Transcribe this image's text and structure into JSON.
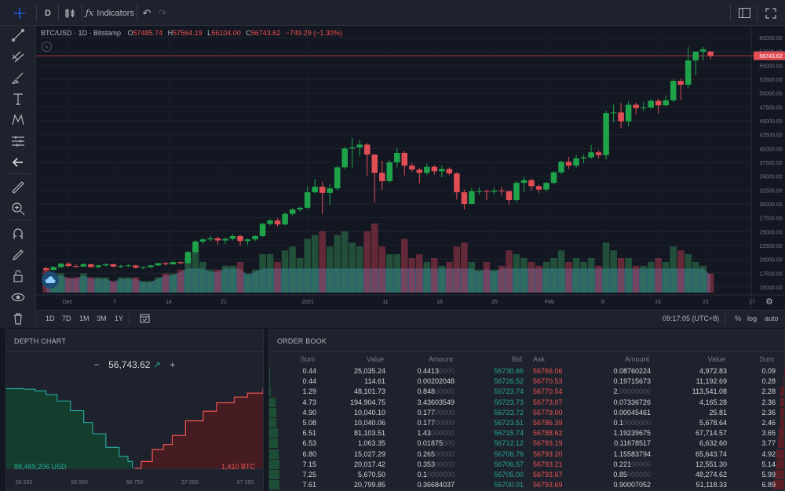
{
  "toolbar": {
    "interval": "D",
    "indicators_label": "Indicators"
  },
  "legend": {
    "symbol": "BTC/USD · 1D · Bitstamp",
    "open_key": "O",
    "open": "57485.74",
    "high_key": "H",
    "high": "57564.19",
    "low_key": "L",
    "low": "56104.00",
    "close_key": "C",
    "close": "56743.62",
    "change": "−749.29 (−1.30%)"
  },
  "price_axis": {
    "labels": [
      "60000.00",
      "57500.00",
      "56743.62",
      "55000.00",
      "52500.00",
      "50000.00",
      "47500.00",
      "45000.00",
      "42500.00",
      "40000.00",
      "37500.00",
      "35000.00",
      "32500.00",
      "30000.00",
      "27500.00",
      "25000.00",
      "22500.00",
      "20000.00",
      "17500.00",
      "15000.00"
    ],
    "last_price": "56743.62"
  },
  "time_axis": {
    "labels": [
      "Dec",
      "7",
      "14",
      "21",
      "2021",
      "11",
      "18",
      "25",
      "Feb",
      "8",
      "15",
      "21",
      "27"
    ]
  },
  "range_bar": {
    "ranges": [
      "1D",
      "7D",
      "1M",
      "3M",
      "1Y"
    ],
    "clock": "09:17:05 (UTC+8)",
    "percent": "%",
    "log": "log",
    "auto": "auto"
  },
  "colors": {
    "up": "#26a69a",
    "down": "#ef5350",
    "up_candle": "#1fa34a",
    "down_candle": "#e04d55",
    "volume_area": "#4a8cc2",
    "background": "#131722"
  },
  "chart_data": {
    "type": "candlestick",
    "title": "BTC/USD · 1D · Bitstamp",
    "ylim": [
      14000,
      61000
    ],
    "x_start": "2020-11-22",
    "x_labels": [
      "Dec",
      "7",
      "14",
      "21",
      "2021",
      "11",
      "18",
      "25",
      "Feb",
      "8",
      "15",
      "21",
      "27"
    ],
    "candles": [
      [
        18400,
        18700,
        17800,
        18100
      ],
      [
        18100,
        18800,
        17900,
        18600
      ],
      [
        18600,
        19400,
        18400,
        19200
      ],
      [
        19200,
        19500,
        18600,
        18800
      ],
      [
        18800,
        19100,
        18500,
        18700
      ],
      [
        18700,
        19300,
        18600,
        19100
      ],
      [
        19100,
        19200,
        18500,
        18600
      ],
      [
        18600,
        19000,
        18400,
        18900
      ],
      [
        18900,
        19300,
        18700,
        19100
      ],
      [
        19100,
        19200,
        18500,
        18700
      ],
      [
        18700,
        19000,
        18400,
        18800
      ],
      [
        18800,
        19100,
        18600,
        18900
      ],
      [
        18900,
        19000,
        18300,
        18500
      ],
      [
        18500,
        18700,
        18200,
        18600
      ],
      [
        18600,
        19000,
        18400,
        18900
      ],
      [
        18900,
        19400,
        18800,
        19300
      ],
      [
        19300,
        19500,
        18900,
        19100
      ],
      [
        19100,
        19700,
        19000,
        19500
      ],
      [
        19500,
        19600,
        19100,
        19300
      ],
      [
        19300,
        21600,
        19200,
        21300
      ],
      [
        21300,
        23500,
        21100,
        23200
      ],
      [
        23200,
        23900,
        22800,
        23600
      ],
      [
        23600,
        24300,
        23200,
        23800
      ],
      [
        23800,
        24100,
        22700,
        23400
      ],
      [
        23400,
        23900,
        22800,
        23700
      ],
      [
        23700,
        24500,
        23400,
        24200
      ],
      [
        24200,
        24400,
        22500,
        23300
      ],
      [
        23300,
        23800,
        22600,
        23600
      ],
      [
        23600,
        24400,
        23300,
        24200
      ],
      [
        24200,
        26600,
        24000,
        26400
      ],
      [
        26400,
        27300,
        26100,
        27000
      ],
      [
        27000,
        27400,
        25900,
        26300
      ],
      [
        26300,
        28500,
        26100,
        28200
      ],
      [
        28200,
        29200,
        27900,
        29000
      ],
      [
        29000,
        29500,
        28600,
        29300
      ],
      [
        29300,
        33200,
        29100,
        32100
      ],
      [
        32100,
        34500,
        31900,
        33100
      ],
      [
        33100,
        34000,
        28200,
        32000
      ],
      [
        32000,
        33600,
        29800,
        32800
      ],
      [
        32800,
        36900,
        32500,
        36600
      ],
      [
        36600,
        40300,
        36300,
        40000
      ],
      [
        40000,
        41900,
        36500,
        40200
      ],
      [
        40200,
        41500,
        38600,
        40700
      ],
      [
        40700,
        41000,
        35100,
        38900
      ],
      [
        38900,
        39000,
        30300,
        35600
      ],
      [
        35600,
        37800,
        32500,
        34100
      ],
      [
        34100,
        37900,
        33800,
        37500
      ],
      [
        37500,
        40100,
        36600,
        39200
      ],
      [
        39200,
        39600,
        35200,
        36900
      ],
      [
        36900,
        37400,
        35800,
        36200
      ],
      [
        36200,
        36500,
        33700,
        35600
      ],
      [
        35600,
        37300,
        35200,
        36700
      ],
      [
        36700,
        37000,
        35300,
        35900
      ],
      [
        35900,
        36900,
        34800,
        36300
      ],
      [
        36300,
        36600,
        35200,
        35500
      ],
      [
        35500,
        35700,
        30800,
        32100
      ],
      [
        32100,
        32600,
        29000,
        30000
      ],
      [
        30000,
        32900,
        29900,
        32300
      ],
      [
        32300,
        33000,
        31700,
        32300
      ],
      [
        32300,
        32600,
        30700,
        32200
      ],
      [
        32200,
        32900,
        31800,
        32400
      ],
      [
        32400,
        33100,
        31500,
        32300
      ],
      [
        32300,
        32400,
        29800,
        30700
      ],
      [
        30700,
        34200,
        30300,
        33800
      ],
      [
        33800,
        34900,
        32100,
        34300
      ],
      [
        34300,
        34600,
        32400,
        33200
      ],
      [
        33200,
        33500,
        32000,
        32600
      ],
      [
        32600,
        34000,
        32200,
        33800
      ],
      [
        33800,
        35900,
        33500,
        35700
      ],
      [
        35700,
        37800,
        35400,
        37600
      ],
      [
        37600,
        38500,
        36300,
        36900
      ],
      [
        36900,
        38800,
        36500,
        38200
      ],
      [
        38200,
        38900,
        37300,
        38400
      ],
      [
        38400,
        40600,
        38100,
        39300
      ],
      [
        39300,
        39700,
        38200,
        38800
      ],
      [
        38800,
        46800,
        38000,
        46400
      ],
      [
        46400,
        47900,
        44800,
        46500
      ],
      [
        46500,
        48200,
        43700,
        44900
      ],
      [
        44900,
        48500,
        44000,
        47900
      ],
      [
        47900,
        48300,
        46200,
        47300
      ],
      [
        47300,
        48400,
        46800,
        47400
      ],
      [
        47400,
        48900,
        47100,
        48600
      ],
      [
        48600,
        49000,
        46300,
        47800
      ],
      [
        47800,
        49600,
        47600,
        48700
      ],
      [
        48700,
        52500,
        48400,
        52200
      ],
      [
        52200,
        52600,
        48800,
        51500
      ],
      [
        51500,
        58300,
        51000,
        55900
      ],
      [
        55900,
        57400,
        53200,
        57500
      ],
      [
        57500,
        58400,
        55900,
        57900
      ],
      [
        57500,
        57600,
        56100,
        56700
      ]
    ],
    "volume": [
      6,
      5,
      5,
      4,
      4,
      5,
      4,
      4,
      4,
      3,
      4,
      4,
      4,
      3,
      3,
      4,
      5,
      5,
      6,
      9,
      12,
      8,
      6,
      6,
      7,
      7,
      8,
      5,
      6,
      10,
      10,
      8,
      11,
      12,
      9,
      14,
      15,
      16,
      12,
      15,
      16,
      13,
      12,
      16,
      18,
      12,
      10,
      10,
      14,
      9,
      10,
      8,
      9,
      7,
      8,
      12,
      13,
      8,
      6,
      8,
      6,
      7,
      11,
      10,
      9,
      8,
      7,
      8,
      9,
      11,
      8,
      9,
      8,
      9,
      7,
      13,
      11,
      9,
      9,
      7,
      7,
      8,
      9,
      8,
      12,
      11,
      10,
      8,
      7,
      5
    ]
  },
  "depth": {
    "title": "DEPTH CHART",
    "mid_price": "56,743.62",
    "minus": "−",
    "plus": "+",
    "bid_total": "88,489,206 USD",
    "ask_total": "1,410 BTC",
    "x_labels": [
      "56 250",
      "56 500",
      "56 750",
      "57 000",
      "57 250"
    ],
    "chart_data": {
      "type": "area",
      "bids": {
        "x": [
          56170,
          56250,
          56300,
          56350,
          56400,
          56460,
          56520,
          56560,
          56620,
          56680,
          56720,
          56740
        ],
        "y": [
          1410,
          1400,
          1370,
          1300,
          1190,
          1020,
          810,
          610,
          370,
          210,
          120,
          0
        ]
      },
      "asks": {
        "x": [
          56750,
          56780,
          56830,
          56880,
          56920,
          56980,
          57060,
          57120,
          57200,
          57260,
          57330
        ],
        "y": [
          0,
          120,
          330,
          420,
          580,
          840,
          1010,
          1160,
          1260,
          1330,
          1410
        ]
      },
      "xlim": [
        56170,
        57330
      ],
      "ylim": [
        0,
        1500
      ]
    }
  },
  "order_book": {
    "title": "ORDER BOOK",
    "headers": [
      "Sum",
      "Value",
      "Amount",
      "Bid",
      "Ask",
      "Amount",
      "Value",
      "Sum"
    ],
    "rows": [
      {
        "bsum": "0.44",
        "bval": "25,035.24",
        "bamt": "0.4413",
        "bamt_dim": "0000",
        "bid": "56730.66",
        "ask": "56766.06",
        "aamt": "0.08760224",
        "aamt_dim": "",
        "aval": "4,972.83",
        "asum": "0.09"
      },
      {
        "bsum": "0.44",
        "bval": "114.61",
        "bamt": "0.00202048",
        "bamt_dim": "",
        "bid": "56726.52",
        "ask": "56770.53",
        "aamt": "0.19715673",
        "aamt_dim": "",
        "aval": "11,192.69",
        "asum": "0.28"
      },
      {
        "bsum": "1.29",
        "bval": "48,101.73",
        "bamt": "0.848",
        "bamt_dim": "00000",
        "bid": "56723.74",
        "ask": "56770.54",
        "aamt": "2.",
        "aamt_dim": "00000000",
        "aval": "113,541.08",
        "asum": "2.28"
      },
      {
        "bsum": "4.73",
        "bval": "194,904.75",
        "bamt": "3.43603549",
        "bamt_dim": "",
        "bid": "56723.73",
        "ask": "56773.07",
        "aamt": "0.07336726",
        "aamt_dim": "",
        "aval": "4,165.28",
        "asum": "2.36"
      },
      {
        "bsum": "4.90",
        "bval": "10,040.10",
        "bamt": "0.177",
        "bamt_dim": "00000",
        "bid": "56723.72",
        "ask": "56779.00",
        "aamt": "0.00045461",
        "aamt_dim": "",
        "aval": "25.81",
        "asum": "2.36"
      },
      {
        "bsum": "5.08",
        "bval": "10,040.06",
        "bamt": "0.177",
        "bamt_dim": "00000",
        "bid": "56723.51",
        "ask": "56786.39",
        "aamt": "0.1",
        "aamt_dim": "0000000",
        "aval": "5,678.64",
        "asum": "2.46"
      },
      {
        "bsum": "6.51",
        "bval": "81,103.51",
        "bamt": "1.43",
        "bamt_dim": "000000",
        "bid": "56715.74",
        "ask": "56788.62",
        "aamt": "1.19239675",
        "aamt_dim": "",
        "aval": "67,714.57",
        "asum": "3.65"
      },
      {
        "bsum": "6.53",
        "bval": "1,063.35",
        "bamt": "0.01875",
        "bamt_dim": "000",
        "bid": "56712.12",
        "ask": "56793.19",
        "aamt": "0.11678517",
        "aamt_dim": "",
        "aval": "6,632.60",
        "asum": "3.77"
      },
      {
        "bsum": "6.80",
        "bval": "15,027.29",
        "bamt": "0.265",
        "bamt_dim": "00000",
        "bid": "56706.76",
        "ask": "56793.20",
        "aamt": "1.15583794",
        "aamt_dim": "",
        "aval": "65,643.74",
        "asum": "4.92"
      },
      {
        "bsum": "7.15",
        "bval": "20,017.42",
        "bamt": "0.353",
        "bamt_dim": "00000",
        "bid": "56706.57",
        "ask": "56793.21",
        "aamt": "0.221",
        "aamt_dim": "00000",
        "aval": "12,551.30",
        "asum": "5.14"
      },
      {
        "bsum": "7.25",
        "bval": "5,670.50",
        "bamt": "0.1",
        "bamt_dim": "0000000",
        "bid": "56705.00",
        "ask": "56793.67",
        "aamt": "0.85",
        "aamt_dim": "000000",
        "aval": "48,274.62",
        "asum": "5.99"
      },
      {
        "bsum": "7.61",
        "bval": "20,799.85",
        "bamt": "0.36684037",
        "bamt_dim": "",
        "bid": "56700.01",
        "ask": "56793.69",
        "aamt": "0.90007052",
        "aamt_dim": "",
        "aval": "51,118.33",
        "asum": "6.89"
      }
    ]
  }
}
